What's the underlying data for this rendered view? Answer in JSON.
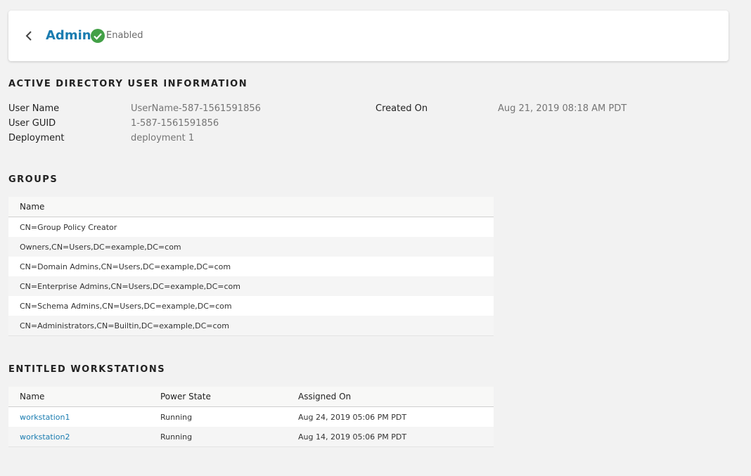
{
  "header": {
    "title": "Admin",
    "status": "Enabled",
    "status_color": "#43a047",
    "back_icon": "chevron-left-icon",
    "status_icon": "check-circle-icon"
  },
  "ad_info": {
    "section_title": "ACTIVE DIRECTORY USER INFORMATION",
    "user_name_label": "User Name",
    "user_name": "UserName-587-1561591856",
    "user_guid_label": "User GUID",
    "user_guid": "1-587-1561591856",
    "deployment_label": "Deployment",
    "deployment": "deployment 1",
    "created_on_label": "Created On",
    "created_on": "Aug 21, 2019 08:18 AM PDT"
  },
  "groups": {
    "section_title": "GROUPS",
    "columns": [
      "Name"
    ],
    "rows": [
      "CN=Group Policy Creator",
      "Owners,CN=Users,DC=example,DC=com",
      "CN=Domain Admins,CN=Users,DC=example,DC=com",
      "CN=Enterprise Admins,CN=Users,DC=example,DC=com",
      "CN=Schema Admins,CN=Users,DC=example,DC=com",
      "CN=Administrators,CN=Builtin,DC=example,DC=com"
    ]
  },
  "workstations": {
    "section_title": "ENTITLED WORKSTATIONS",
    "columns": [
      "Name",
      "Power State",
      "Assigned On"
    ],
    "rows": [
      {
        "name": "workstation1",
        "power_state": "Running",
        "assigned_on": "Aug 24, 2019 05:06 PM PDT"
      },
      {
        "name": "workstation2",
        "power_state": "Running",
        "assigned_on": "Aug 14, 2019 05:06 PM PDT"
      }
    ]
  },
  "colors": {
    "link": "#1a7cb0",
    "background": "#f2f2f2"
  }
}
